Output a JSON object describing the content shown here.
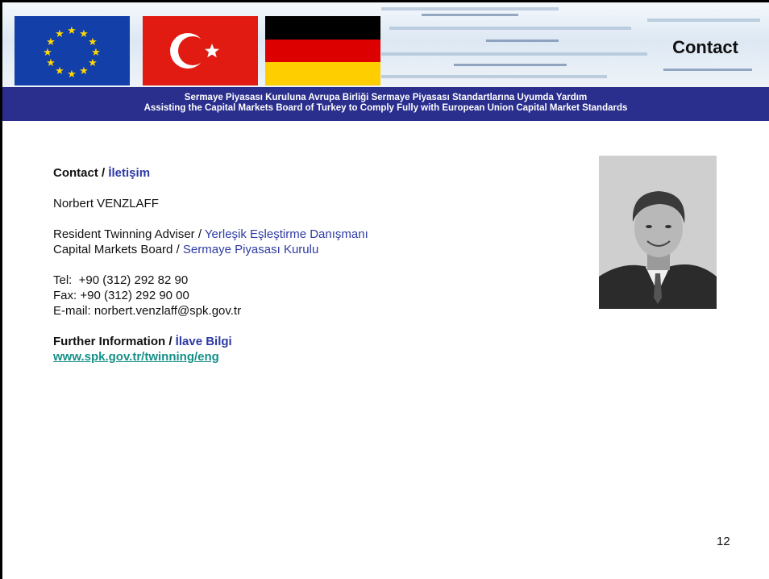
{
  "header": {
    "title": "Contact",
    "subtitle_tr": "Sermaye Piyasası Kuruluna Avrupa Birliği Sermaye Piyasası Standartlarına Uyumda Yardım",
    "subtitle_en": "Assisting the Capital Markets Board of Turkey to Comply Fully with European Union Capital Market Standards",
    "flags": [
      "eu-flag",
      "turkey-flag",
      "germany-flag"
    ]
  },
  "body": {
    "contact_heading": "Contact /",
    "contact_heading_tr": "İletişim",
    "name": "Norbert VENZLAFF",
    "role_en": "Resident Twinning Adviser /",
    "role_tr": "Yerleşik Eşleştirme Danışmanı",
    "org_en": "Capital Markets Board /",
    "org_tr": "Sermaye Piyasası Kurulu",
    "tel": "Tel:  +90 (312) 292 82 90",
    "fax": "Fax: +90 (312) 292 90 00",
    "email": "E-mail: norbert.venzlaff@spk.gov.tr",
    "further_heading": "Further Information /",
    "further_heading_tr": "İlave Bilgi",
    "link": "www.spk.gov.tr/twinning/eng"
  },
  "footer": {
    "page_number": "12"
  },
  "colors": {
    "banner_bar": "#2a2e8c",
    "tr_text": "#2d3aa3",
    "link": "#159088"
  }
}
